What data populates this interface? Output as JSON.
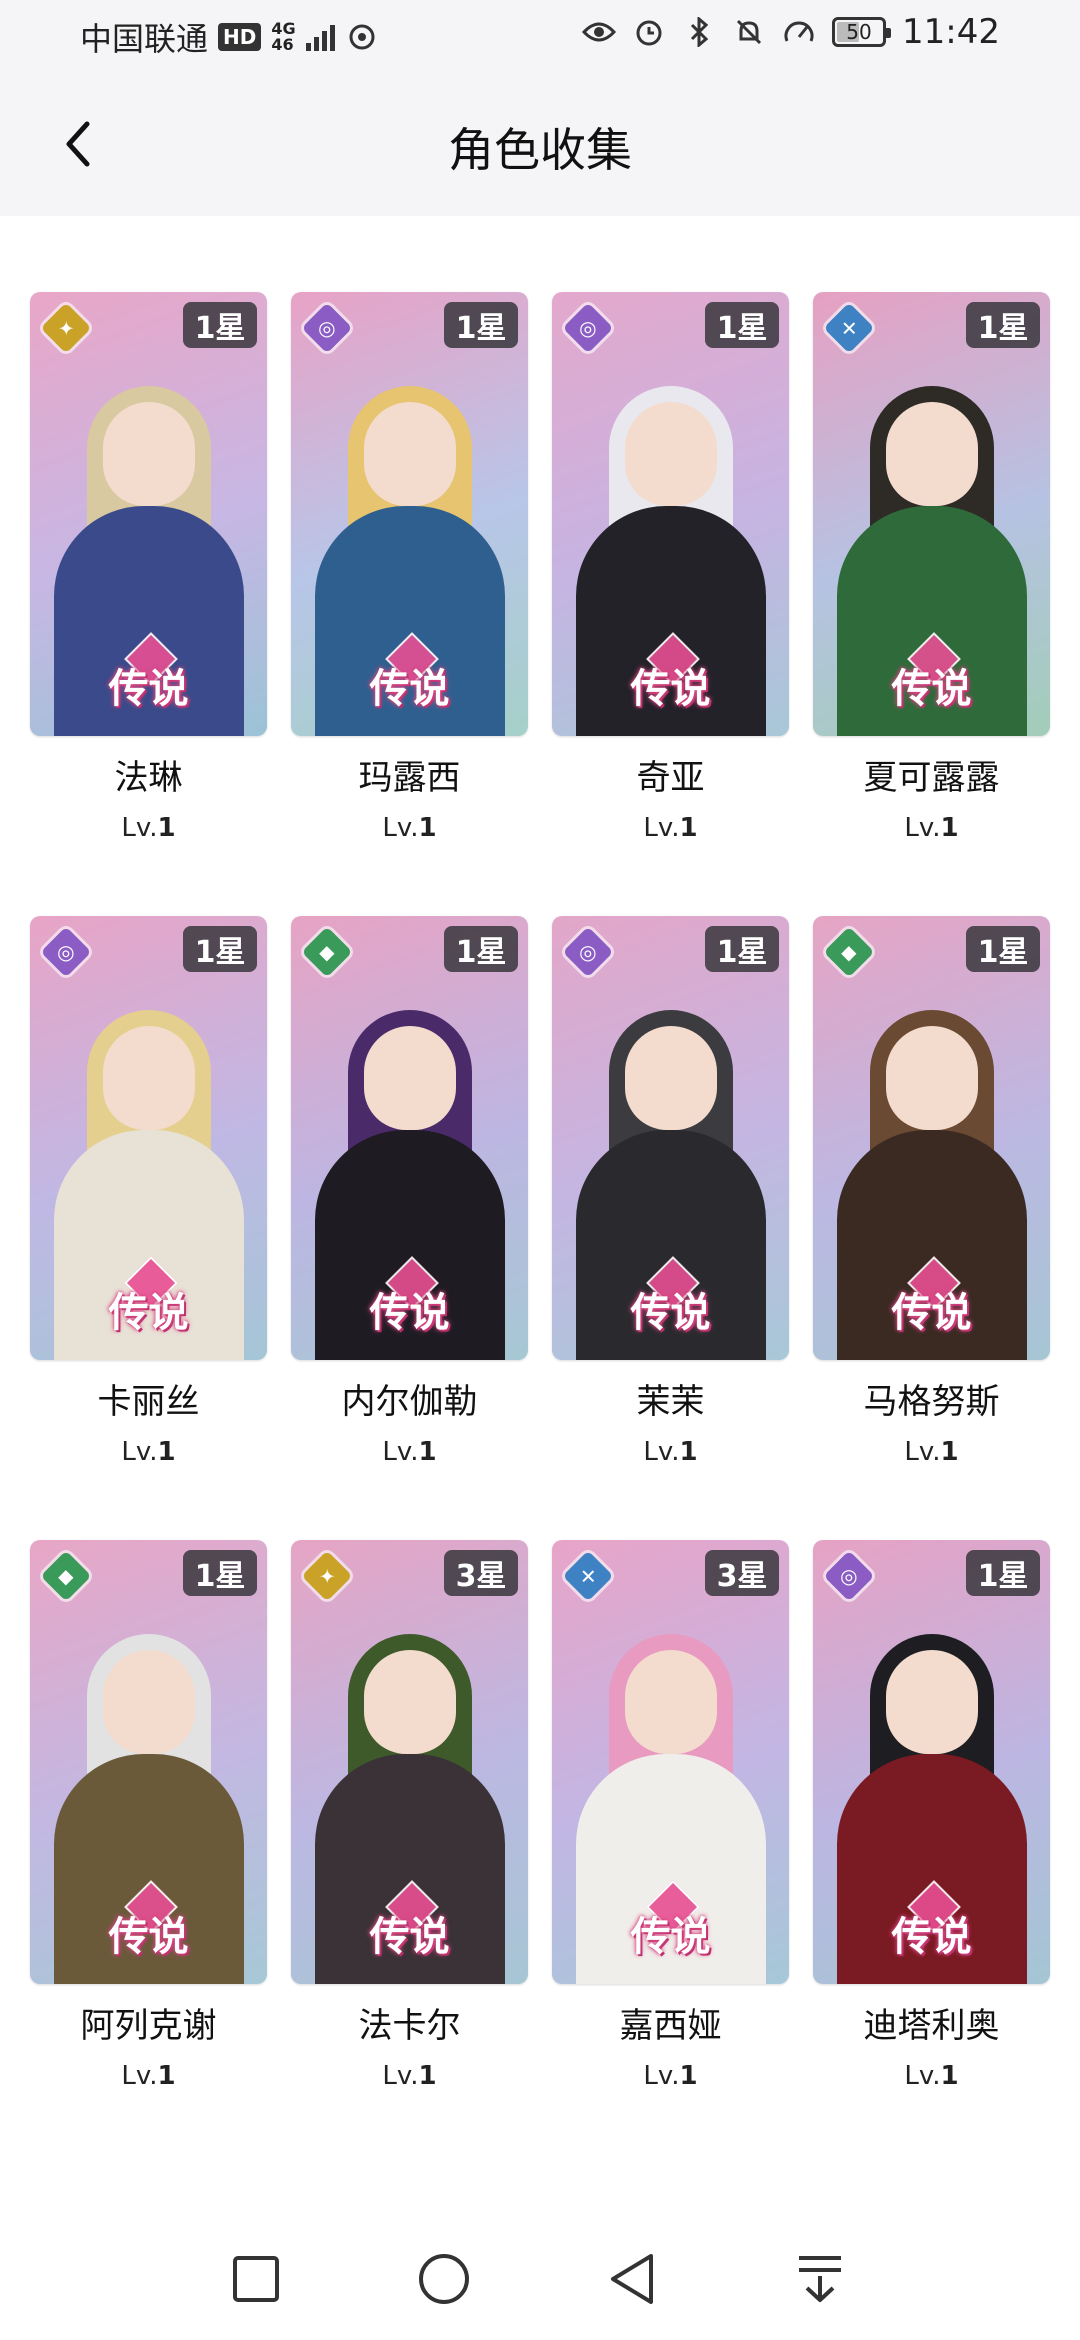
{
  "status_bar": {
    "carrier": "中国联通",
    "hd": "HD",
    "network_top": "4G",
    "network_bottom": "46",
    "battery": "50",
    "time": "11:42",
    "battery_level_percent": 50
  },
  "header": {
    "title": "角色收集"
  },
  "characters": [
    {
      "name": "法琳",
      "stars": "1星",
      "rarity": "传说",
      "level_prefix": "Lv.",
      "level": "1",
      "element": "light",
      "element_color": "#c9a227",
      "bg": [
        "#e9a6c7",
        "#c7b7e4",
        "#9bc3d6"
      ],
      "hair": "#d8c9a0",
      "body": "#3a4a8a"
    },
    {
      "name": "玛露西",
      "stars": "1星",
      "rarity": "传说",
      "level_prefix": "Lv.",
      "level": "1",
      "element": "arcane",
      "element_color": "#8a5cc4",
      "bg": [
        "#e8a2c6",
        "#b8c6e8",
        "#a5d0c9"
      ],
      "hair": "#e6c470",
      "body": "#2f5f8f"
    },
    {
      "name": "奇亚",
      "stars": "1星",
      "rarity": "传说",
      "level_prefix": "Lv.",
      "level": "1",
      "element": "arcane",
      "element_color": "#8a5cc4",
      "bg": [
        "#e4a8cc",
        "#c6b4e2",
        "#a8c8d8"
      ],
      "hair": "#e8e8ee",
      "body": "#222228"
    },
    {
      "name": "夏可露露",
      "stars": "1星",
      "rarity": "传说",
      "level_prefix": "Lv.",
      "level": "1",
      "element": "water",
      "element_color": "#3e82c4",
      "bg": [
        "#e6a0c2",
        "#b6c2e2",
        "#a2cdb8"
      ],
      "hair": "#2e2a26",
      "body": "#2f6a3a"
    },
    {
      "name": "卡丽丝",
      "stars": "1星",
      "rarity": "传说",
      "level_prefix": "Lv.",
      "level": "1",
      "element": "arcane",
      "element_color": "#8a5cc4",
      "bg": [
        "#e8a4c6",
        "#c0b8e4",
        "#a4c6d6"
      ],
      "hair": "#e4cf8e",
      "body": "#e8e2d6"
    },
    {
      "name": "内尔伽勒",
      "stars": "1星",
      "rarity": "传说",
      "level_prefix": "Lv.",
      "level": "1",
      "element": "nature",
      "element_color": "#3a9a5a",
      "bg": [
        "#e7a3c4",
        "#bdb6e2",
        "#a6c8d4"
      ],
      "hair": "#4b2a6a",
      "body": "#1e1c22"
    },
    {
      "name": "茉茉",
      "stars": "1星",
      "rarity": "传说",
      "level_prefix": "Lv.",
      "level": "1",
      "element": "arcane",
      "element_color": "#8a5cc4",
      "bg": [
        "#e3a6c8",
        "#c4b6e2",
        "#a8c8d8"
      ],
      "hair": "#3c3c40",
      "body": "#2a2a2e"
    },
    {
      "name": "马格努斯",
      "stars": "1星",
      "rarity": "传说",
      "level_prefix": "Lv.",
      "level": "1",
      "element": "nature",
      "element_color": "#3a9a5a",
      "bg": [
        "#e6a4c4",
        "#bcb8e2",
        "#a6c6d4"
      ],
      "hair": "#6a4a32",
      "body": "#3a2a22"
    },
    {
      "name": "阿列克谢",
      "stars": "1星",
      "rarity": "传说",
      "level_prefix": "Lv.",
      "level": "1",
      "element": "nature",
      "element_color": "#3a9a5a",
      "bg": [
        "#e8a6c6",
        "#c2b8e2",
        "#a6c8d6"
      ],
      "hair": "#e2e2e2",
      "body": "#6a5a3a"
    },
    {
      "name": "法卡尔",
      "stars": "3星",
      "rarity": "传说",
      "level_prefix": "Lv.",
      "level": "1",
      "element": "light",
      "element_color": "#c9a227",
      "bg": [
        "#e6a4c4",
        "#bcb8e2",
        "#a6c6d4"
      ],
      "hair": "#3e5a2a",
      "body": "#3a3236"
    },
    {
      "name": "嘉西娅",
      "stars": "3星",
      "rarity": "传说",
      "level_prefix": "Lv.",
      "level": "1",
      "element": "water",
      "element_color": "#3e82c4",
      "bg": [
        "#e8a4c8",
        "#c2b6e4",
        "#a6c8d8"
      ],
      "hair": "#e89ac0",
      "body": "#f0eeea"
    },
    {
      "name": "迪塔利奥",
      "stars": "1星",
      "rarity": "传说",
      "level_prefix": "Lv.",
      "level": "1",
      "element": "arcane",
      "element_color": "#8a5cc4",
      "bg": [
        "#e6a2c4",
        "#bcb6e2",
        "#a4c6d4"
      ],
      "hair": "#1e1e22",
      "body": "#7a1a22"
    }
  ],
  "nav_bar": {
    "buttons": [
      "square-icon",
      "circle-icon",
      "triangle-back-icon",
      "collapse-icon"
    ]
  }
}
